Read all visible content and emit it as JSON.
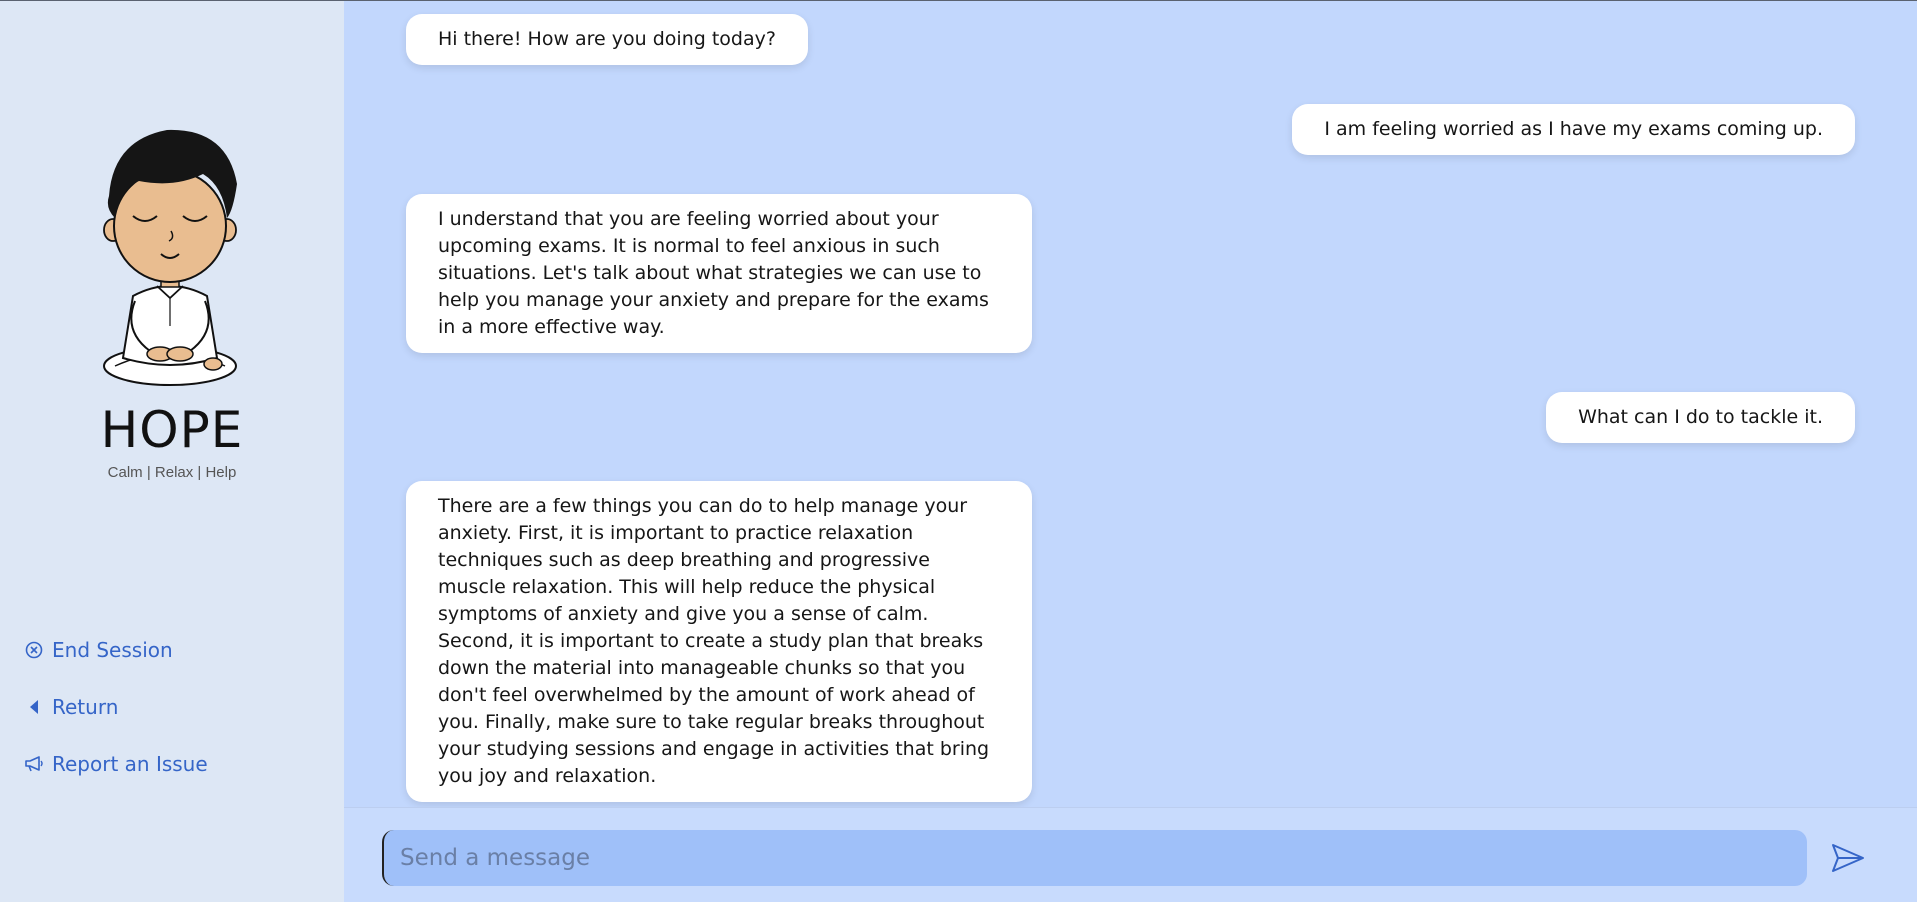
{
  "brand": {
    "title": "HOPE",
    "tagline": "Calm | Relax | Help"
  },
  "nav": {
    "end_session": "End Session",
    "return": "Return",
    "report": "Report an Issue"
  },
  "messages": [
    {
      "role": "bot",
      "text": "Hi there! How are you doing today?"
    },
    {
      "role": "user",
      "text": "I am feeling worried as I have my exams coming up."
    },
    {
      "role": "bot",
      "text": "I understand that you are feeling worried about your upcoming exams. It is normal to feel anxious in such situations. Let's talk about what strategies we can use to help you manage your anxiety and prepare for the exams in a more effective way."
    },
    {
      "role": "user",
      "text": "What can I do to tackle it."
    },
    {
      "role": "bot",
      "text": "There are a few things you can do to help manage your anxiety. First, it is important to practice relaxation techniques such as deep breathing and progressive muscle relaxation. This will help reduce the physical symptoms of anxiety and give you a sense of calm. Second, it is important to create a study plan that breaks down the material into manageable chunks so that you don't feel overwhelmed by the amount of work ahead of you. Finally, make sure to take regular breaks throughout your studying sessions and engage in activities that bring you joy and relaxation."
    }
  ],
  "composer": {
    "placeholder": "Send a message",
    "send_icon": "send-icon"
  },
  "colors": {
    "sidebar_bg": "#dde7f5",
    "chat_bg": "#c2d7fd",
    "input_bg": "#9fc0f9",
    "accent": "#3565c8"
  }
}
